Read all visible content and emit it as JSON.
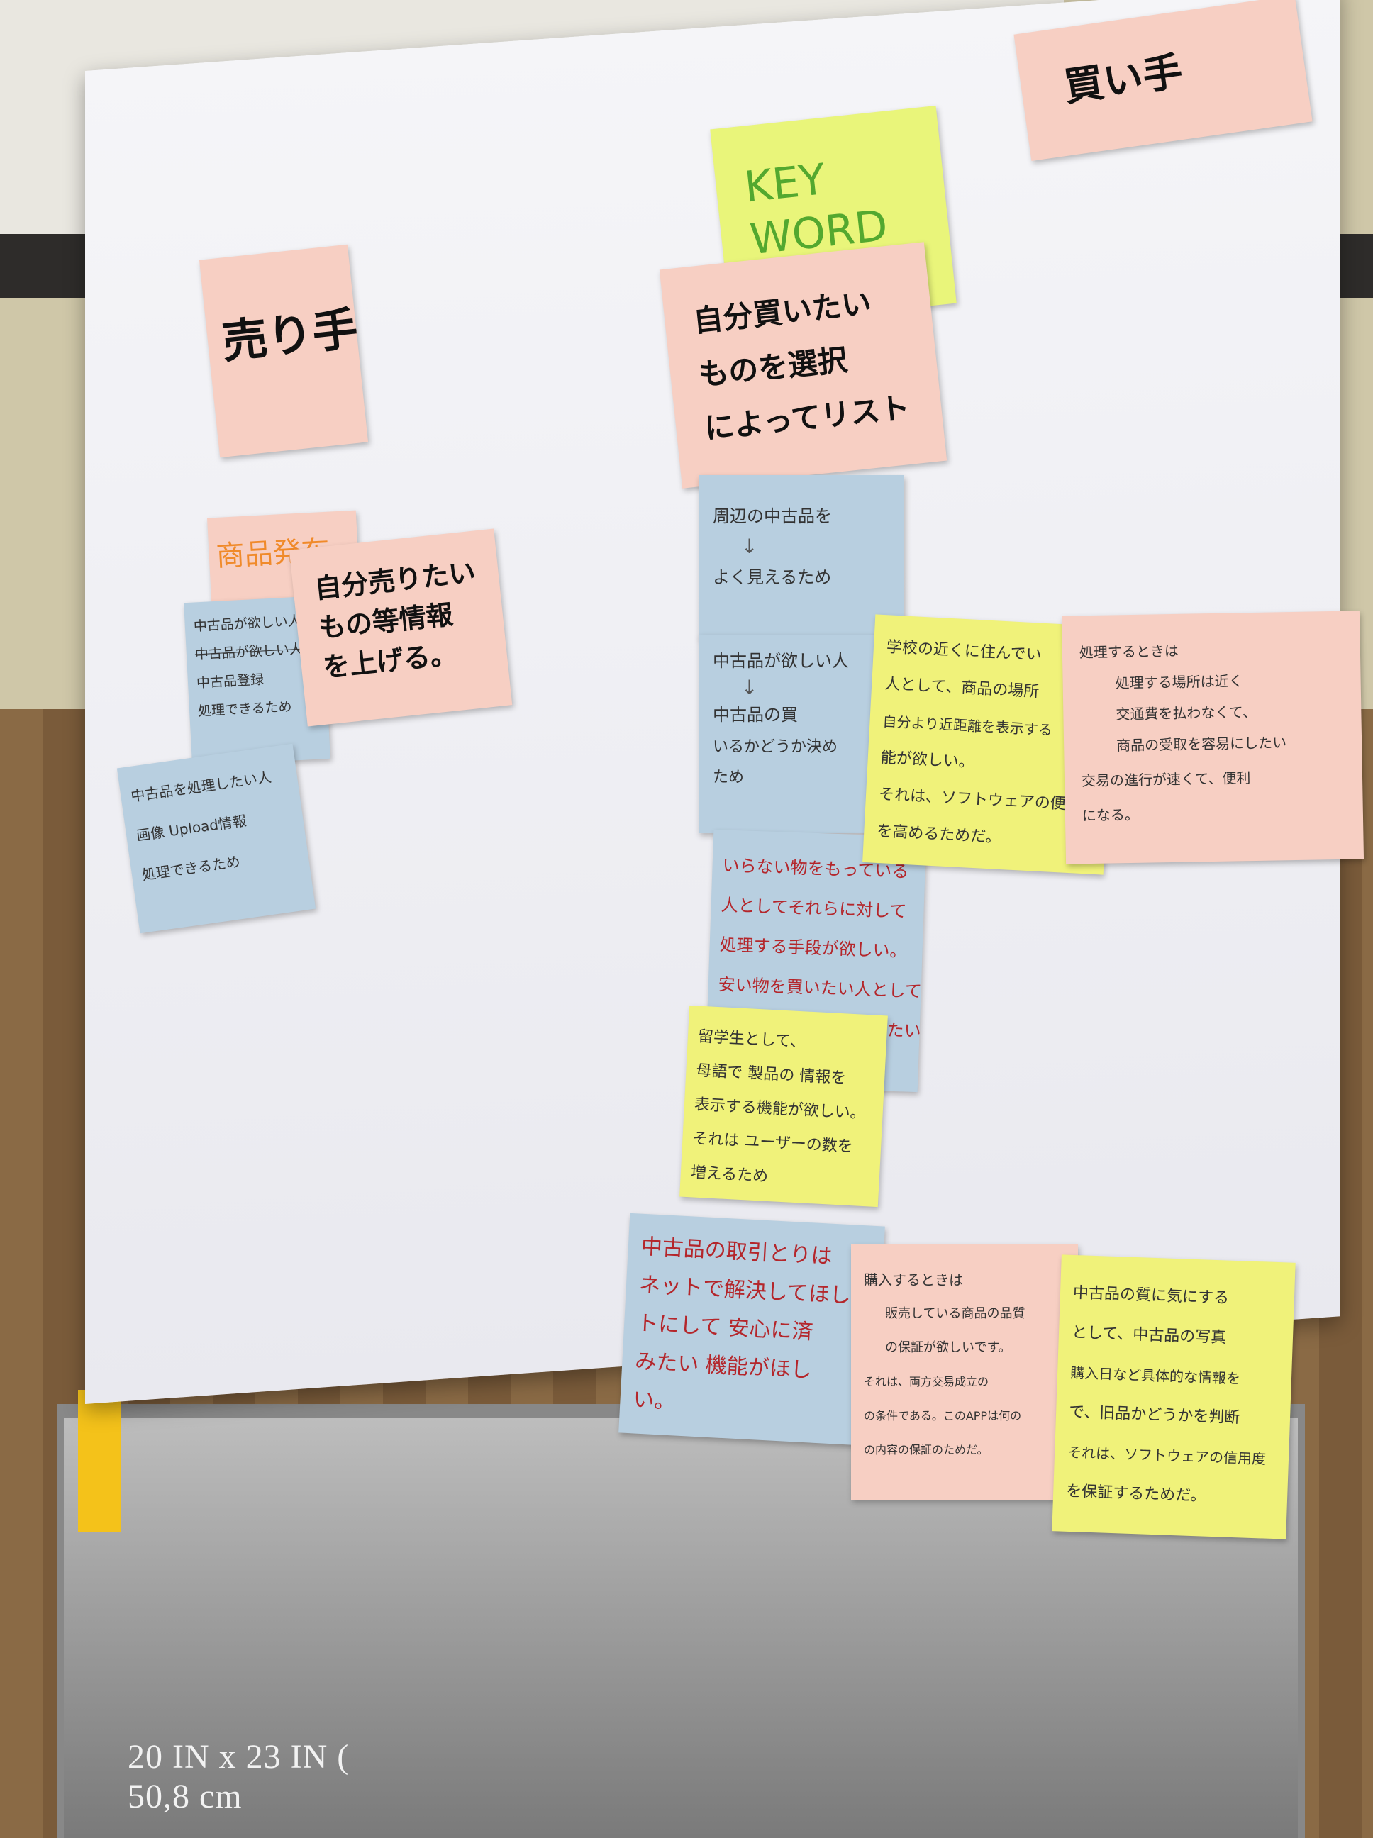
{
  "board": {
    "size_label_1": "20 IN x 23 IN (",
    "size_label_2": "50,8 cm"
  },
  "notes": {
    "uriteh": {
      "title": "売り手"
    },
    "kaiteh": {
      "title": "買い手"
    },
    "keyword": {
      "line1": "KEY",
      "line2": "WORD"
    },
    "seller_pub": {
      "tag": "商品発布",
      "line1": "自分売りたい",
      "line2": "もの等情報",
      "line3": "を上げる。"
    },
    "buyer_list": {
      "line1": "自分買いたい",
      "line2": "ものを選択",
      "line3": "によってリスト"
    },
    "seller_blue1": {
      "line1": "中古品が欲しい人",
      "line2": "中古品が欲しい人",
      "line3": "中古品登録",
      "line4": "処理できるため"
    },
    "seller_blue2": {
      "line1": "中古品を処理したい人",
      "line2": "画像 Upload情報",
      "line3": "処理できるため"
    },
    "buyer_blue1": {
      "line1": "周辺の中古品を",
      "line2": "よく見えるため"
    },
    "buyer_blue2": {
      "line1": "中古品が欲しい人",
      "line2": "中古品の買",
      "line3": "いるかどうか決め",
      "line4": "ため"
    },
    "buyer_blue3": {
      "line1": "いらない物をもっている",
      "line2": "人としてそれらに対して",
      "line3": "処理する手段が欲しい。",
      "line4": "安い物を買いたい人として",
      "line5": "中古品の情報を入手したい"
    },
    "buyer_yellow1": {
      "line1": "留学生として、",
      "line2": "母語で 製品の 情報を",
      "line3": "表示する機能が欲しい。",
      "line4": "それは ユーザーの数を",
      "line5": "増えるため"
    },
    "buyer_blue4": {
      "line1": "中古品の取引とりは",
      "line2": "ネットで解決してほし",
      "line3": "トにして 安心に済",
      "line4": "みたい 機能がほし",
      "line5": "い。"
    },
    "mid_yellow": {
      "line1": "学校の近くに住んでい",
      "line2": "人として、商品の場所",
      "line3": "自分より近距離を表示する",
      "line4": "能が欲しい。",
      "line5": "それは、ソフトウェアの便利",
      "line6": "を高めるためだ。"
    },
    "right_pink1": {
      "line1": "処理するときは",
      "line2": "処理する場所は近く",
      "line3": "交通費を払わなくて、",
      "line4": "商品の受取を容易にしたい",
      "line5": "交易の進行が速くて、便利",
      "line6": "になる。"
    },
    "bottom_pink": {
      "line1": "購入するときは",
      "line2": "販売している商品の品質",
      "line3": "の保証が欲しいです。",
      "line4": "それは、両方交易成立の",
      "line5": "の条件である。このAPPは何の",
      "line6": "の内容の保証のためだ。"
    },
    "bottom_yellow": {
      "line1": "中古品の質に気にする",
      "line2": "として、中古品の写真",
      "line3": "購入日など具体的な情報を",
      "line4": "で、旧品かどうかを判断",
      "line5": "それは、ソフトウェアの信用度",
      "line6": "を保証するためだ。"
    }
  },
  "colors": {
    "pink": "#f7cfc3",
    "blue": "#b8cfe0",
    "yellow": "#f0f27a",
    "paper": "#f3f3f6"
  }
}
